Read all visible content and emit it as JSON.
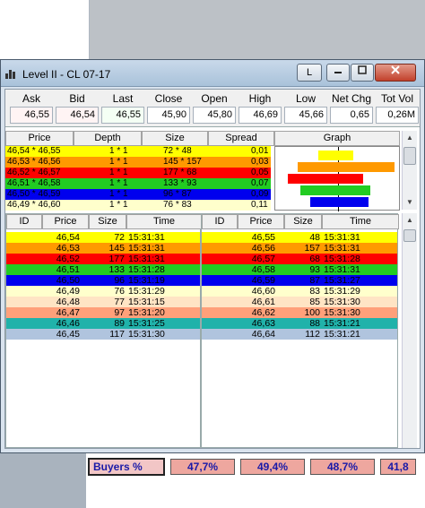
{
  "window": {
    "title": "Level II - CL 07-17",
    "l_button": "L"
  },
  "summary": {
    "headers": [
      "Ask",
      "Bid",
      "Last",
      "Close",
      "Open",
      "High",
      "Low",
      "Net Chg",
      "Tot Vol"
    ],
    "values": [
      "46,55",
      "46,54",
      "46,55",
      "45,90",
      "45,80",
      "46,69",
      "45,66",
      "0,65",
      "0,26M"
    ]
  },
  "depth": {
    "headers": [
      "Price",
      "Depth",
      "Size",
      "Spread",
      "Graph"
    ],
    "rows": [
      {
        "price": "46,54 * 46,55",
        "depth": "1 * 1",
        "size": "72 * 48",
        "spread": "0,01",
        "bg": "#ffff00",
        "fg": "#000000"
      },
      {
        "price": "46,53 * 46,56",
        "depth": "1 * 1",
        "size": "145 * 157",
        "spread": "0,03",
        "bg": "#ff9900",
        "fg": "#000000"
      },
      {
        "price": "46,52 * 46,57",
        "depth": "1 * 1",
        "size": "177 * 68",
        "spread": "0,05",
        "bg": "#ff0000",
        "fg": "#000000"
      },
      {
        "price": "46,51 * 46,58",
        "depth": "1 * 1",
        "size": "133 * 93",
        "spread": "0,07",
        "bg": "#22cc22",
        "fg": "#000000"
      },
      {
        "price": "46,50 * 46,59",
        "depth": "1 * 1",
        "size": "96 * 87",
        "spread": "0,09",
        "bg": "#0000ee",
        "fg": "#000000"
      },
      {
        "price": "46,49 * 46,60",
        "depth": "1 * 1",
        "size": "76 * 83",
        "spread": "0,11",
        "bg": "#ffffcc",
        "fg": "#000000"
      }
    ],
    "graph": {
      "center": 0.5,
      "bars": [
        {
          "bid": 0.16,
          "ask": 0.12,
          "color": "#ffff00"
        },
        {
          "bid": 0.32,
          "ask": 0.45,
          "color": "#ff9900"
        },
        {
          "bid": 0.4,
          "ask": 0.2,
          "color": "#ff0000"
        },
        {
          "bid": 0.3,
          "ask": 0.26,
          "color": "#22cc22"
        },
        {
          "bid": 0.22,
          "ask": 0.24,
          "color": "#0000ee"
        }
      ]
    }
  },
  "trades": {
    "headers": [
      "ID",
      "Price",
      "Size",
      "Time"
    ],
    "left": [
      {
        "price": "46,54",
        "size": "72",
        "time": "15:31:31",
        "bg": "#ffff00"
      },
      {
        "price": "46,53",
        "size": "145",
        "time": "15:31:31",
        "bg": "#ff9900"
      },
      {
        "price": "46,52",
        "size": "177",
        "time": "15:31:31",
        "bg": "#ff0000"
      },
      {
        "price": "46,51",
        "size": "133",
        "time": "15:31:28",
        "bg": "#22cc22"
      },
      {
        "price": "46,50",
        "size": "96",
        "time": "15:31:19",
        "bg": "#0000ee"
      },
      {
        "price": "46,49",
        "size": "76",
        "time": "15:31:29",
        "bg": "#ffffcc"
      },
      {
        "price": "46,48",
        "size": "77",
        "time": "15:31:15",
        "bg": "#ffe4c4"
      },
      {
        "price": "46,47",
        "size": "97",
        "time": "15:31:20",
        "bg": "#ffa07a"
      },
      {
        "price": "46,46",
        "size": "89",
        "time": "15:31:25",
        "bg": "#20b2aa"
      },
      {
        "price": "46,45",
        "size": "117",
        "time": "15:31:30",
        "bg": "#b0c4de"
      }
    ],
    "right": [
      {
        "price": "46,55",
        "size": "48",
        "time": "15:31:31",
        "bg": "#ffff00"
      },
      {
        "price": "46,56",
        "size": "157",
        "time": "15:31:31",
        "bg": "#ff9900"
      },
      {
        "price": "46,57",
        "size": "68",
        "time": "15:31:28",
        "bg": "#ff0000"
      },
      {
        "price": "46,58",
        "size": "93",
        "time": "15:31:31",
        "bg": "#22cc22"
      },
      {
        "price": "46,59",
        "size": "87",
        "time": "15:31:27",
        "bg": "#0000ee"
      },
      {
        "price": "46,60",
        "size": "83",
        "time": "15:31:29",
        "bg": "#ffffcc"
      },
      {
        "price": "46,61",
        "size": "85",
        "time": "15:31:30",
        "bg": "#ffe4c4"
      },
      {
        "price": "46,62",
        "size": "100",
        "time": "15:31:30",
        "bg": "#ffa07a"
      },
      {
        "price": "46,63",
        "size": "88",
        "time": "15:31:21",
        "bg": "#20b2aa"
      },
      {
        "price": "46,64",
        "size": "112",
        "time": "15:31:21",
        "bg": "#b0c4de"
      }
    ]
  },
  "background": {
    "buyers_label": "Buyers %",
    "buyers_values": [
      "47,7%",
      "49,4%",
      "48,7%",
      "41,8"
    ]
  }
}
